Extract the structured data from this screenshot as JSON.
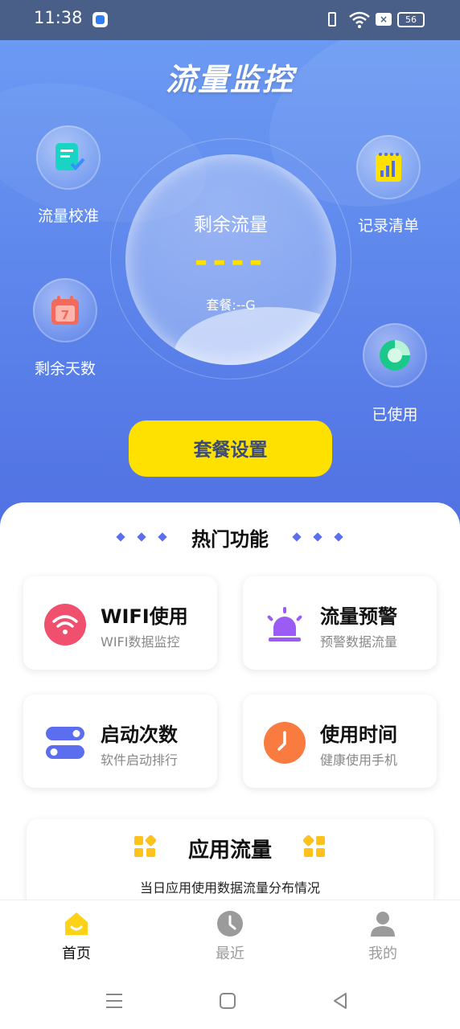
{
  "status_bar": {
    "time": "11:38",
    "battery": "56"
  },
  "header": {
    "title": "流量监控"
  },
  "side_buttons": {
    "calibrate": "流量校准",
    "records": "记录清单",
    "days_left": "剩余天数",
    "used": "已使用"
  },
  "meter": {
    "label": "剩余流量",
    "value": "----",
    "plan": "套餐:--G"
  },
  "plan_button": "套餐设置",
  "hot_section": {
    "title": "热门功能"
  },
  "features": [
    {
      "title": "WIFI使用",
      "subtitle": "WIFI数据监控"
    },
    {
      "title": "流量预警",
      "subtitle": "预警数据流量"
    },
    {
      "title": "启动次数",
      "subtitle": "软件启动排行"
    },
    {
      "title": "使用时间",
      "subtitle": "健康使用手机"
    }
  ],
  "app_traffic": {
    "title": "应用流量",
    "subtitle": "当日应用使用数据流量分布情况"
  },
  "tabs": [
    {
      "label": "首页",
      "active": true
    },
    {
      "label": "最近",
      "active": false
    },
    {
      "label": "我的",
      "active": false
    }
  ],
  "colors": {
    "accent_yellow": "#ffe100",
    "hero_blue": "#5b82ea",
    "wifi_pink": "#f0506e",
    "alert_purple": "#9b5cf5",
    "toggle_blue": "#5b6ef0",
    "clock_orange": "#f97b3f",
    "tab_inactive": "#9b9b9b"
  },
  "icons": [
    "calibrate-doc-icon",
    "calendar-icon",
    "records-chart-icon",
    "pie-used-icon",
    "wifi-icon",
    "alarm-light-icon",
    "toggle-icon",
    "clock-icon",
    "grid-icon",
    "home-icon",
    "clock-tab-icon",
    "user-icon"
  ]
}
